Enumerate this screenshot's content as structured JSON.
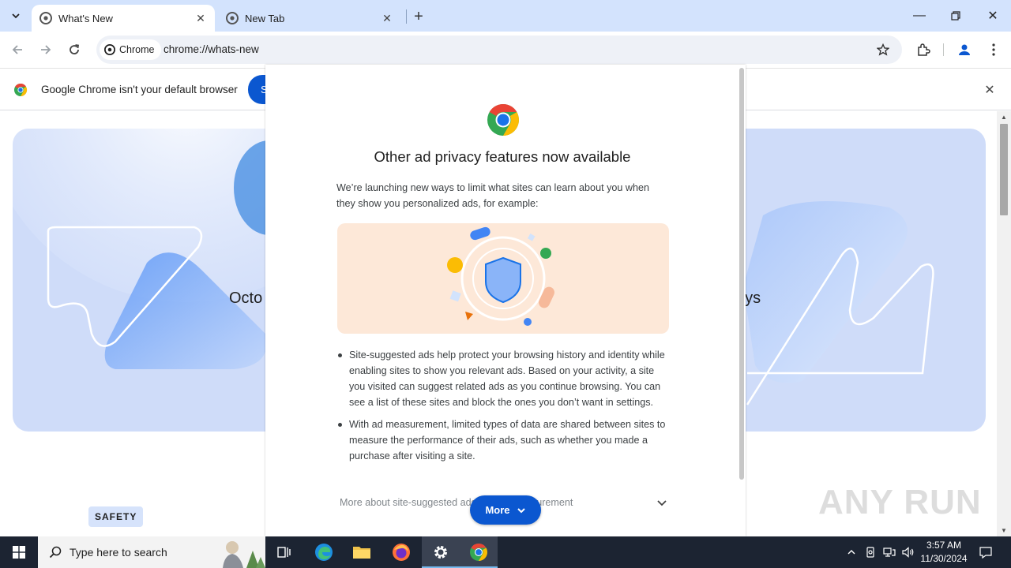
{
  "tabs": [
    {
      "title": "What's New",
      "active": true
    },
    {
      "title": "New Tab",
      "active": false
    }
  ],
  "toolbar": {
    "chip_label": "Chrome",
    "url": "chrome://whats-new"
  },
  "infobar": {
    "message": "Google Chrome isn't your default browser",
    "button_label": "Set as default"
  },
  "hero": {
    "left_text": "Octo",
    "right_text": "ays",
    "badge": "SAFETY"
  },
  "dialog": {
    "title": "Other ad privacy features now available",
    "intro": "We’re launching new ways to limit what sites can learn about you when they show you personalized ads, for example:",
    "bullets": [
      "Site-suggested ads help protect your browsing history and identity while enabling sites to show you relevant ads. Based on your activity, a site you visited can suggest related ads as you continue browsing. You can see a list of these sites and block the ones you don’t want in settings.",
      "With ad measurement, limited types of data are shared between sites to measure the performance of their ads, such as whether you made a purchase after visiting a site."
    ],
    "more_about": "More about site-suggested ads and ad measurement",
    "more_button": "More"
  },
  "taskbar": {
    "search_placeholder": "Type here to search",
    "time": "3:57 AM",
    "date": "11/30/2024"
  },
  "watermark": "ANY RUN",
  "colors": {
    "tabstrip": "#d3e3fd",
    "accent_button": "#0b57d0",
    "hero_bg": "#cfdcf9",
    "illustration_bg": "#fde8d8",
    "taskbar": "#1c2432"
  }
}
